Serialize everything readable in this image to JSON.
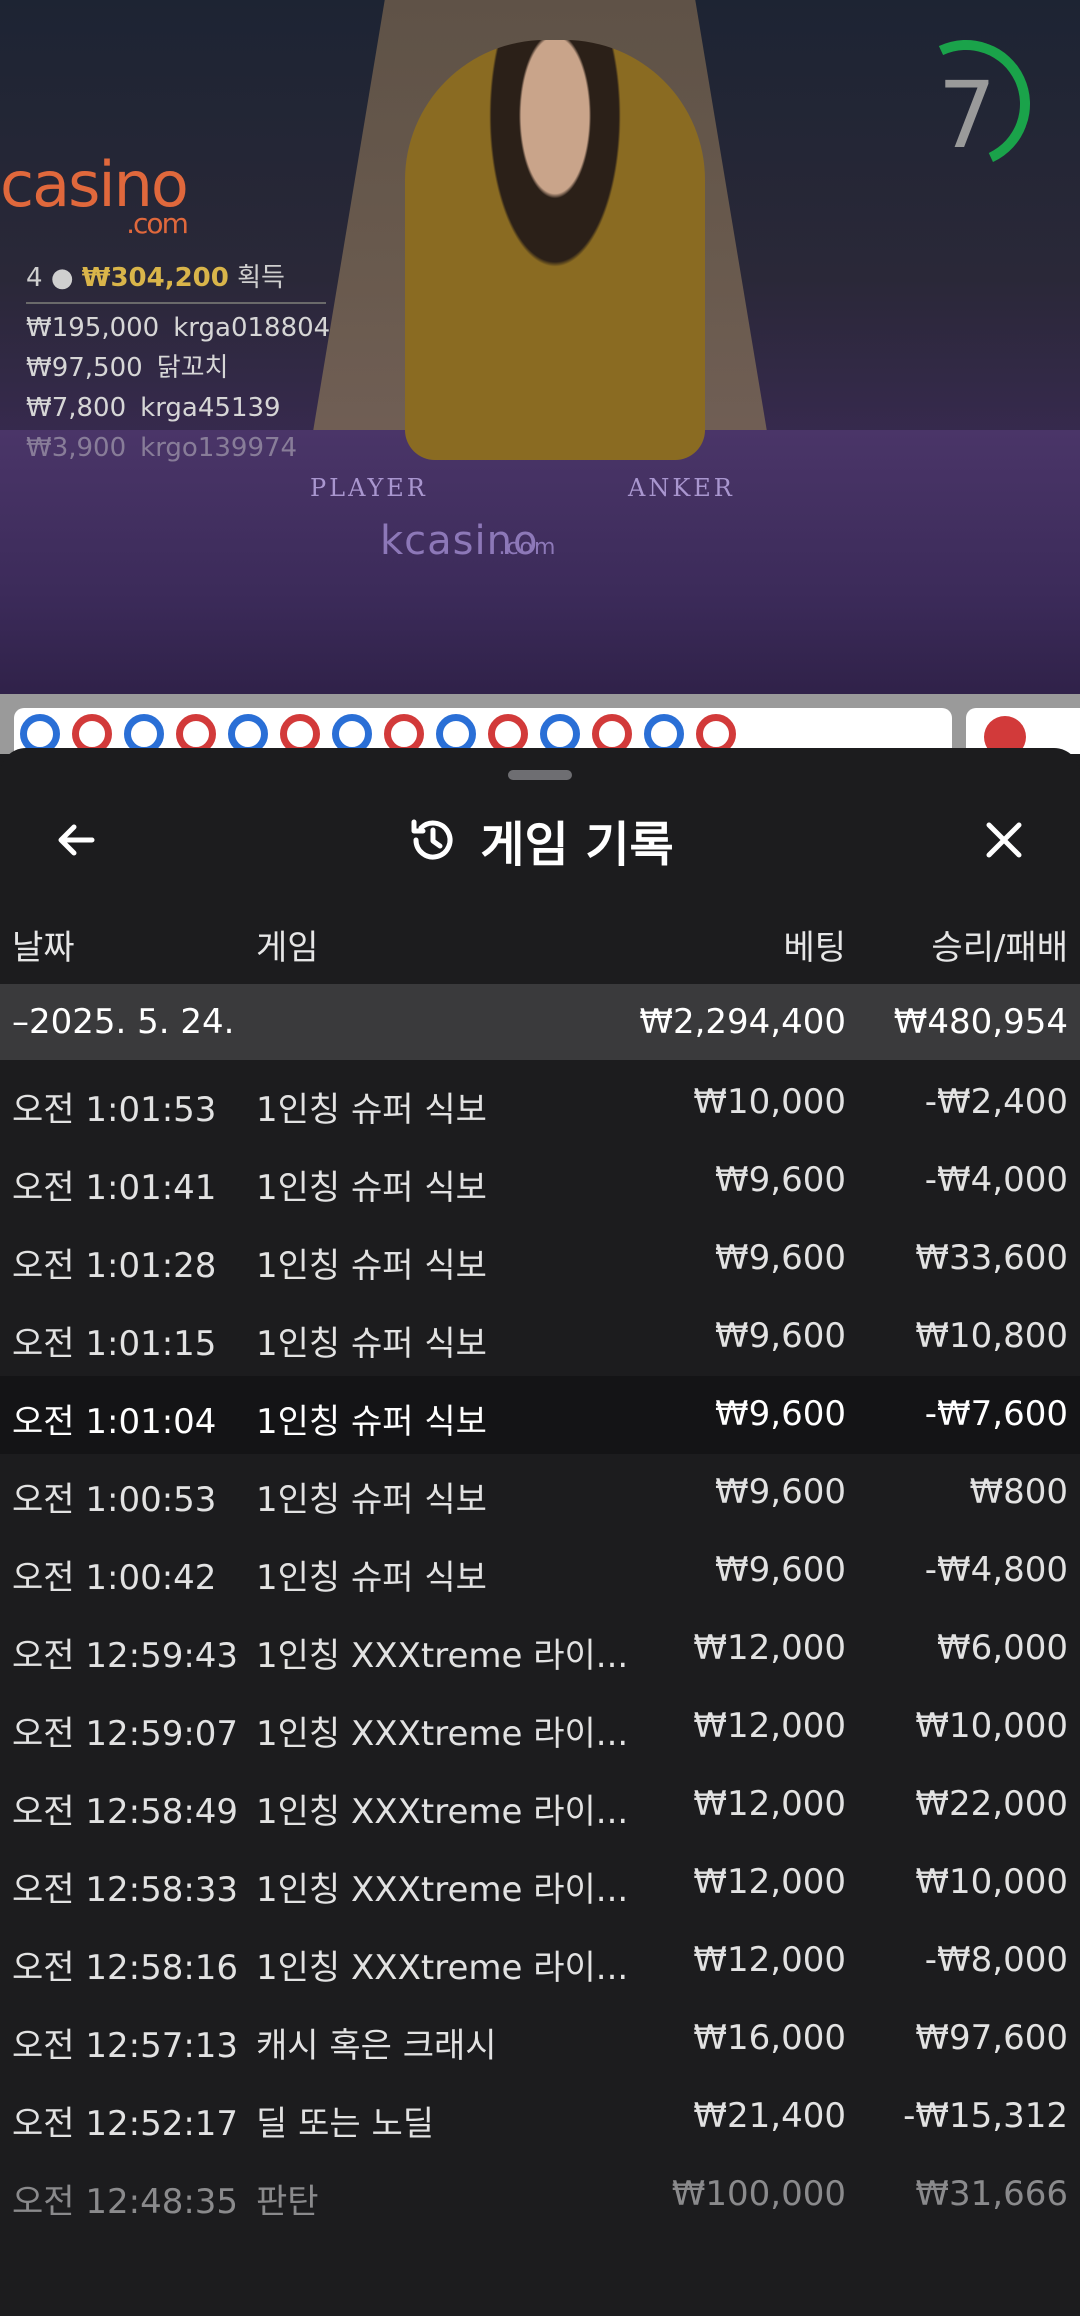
{
  "video": {
    "countdown": "7",
    "brand": "casino",
    "brand_sub": ".com",
    "felt_brand": "kcasino",
    "felt_brand_sub": ".com",
    "player_label": "PLAYER",
    "banker_label": "ANKER",
    "winners_header": {
      "count": "4",
      "total": "₩304,200",
      "suffix": "획득"
    },
    "winners": [
      {
        "amount": "₩195,000",
        "user": "krga018804"
      },
      {
        "amount": "₩97,500",
        "user": "닭꼬치"
      },
      {
        "amount": "₩7,800",
        "user": "krga45139"
      },
      {
        "amount": "₩3,900",
        "user": "krgo139974"
      }
    ]
  },
  "sheet": {
    "title": "게임 기록",
    "columns": {
      "date": "날짜",
      "game": "게임",
      "bet": "베팅",
      "result": "승리/패배"
    },
    "summary": {
      "date": "–2025. 5. 24.",
      "bet": "₩2,294,400",
      "result": "₩480,954"
    },
    "rows": [
      {
        "time": "오전 1:01:53",
        "game": "1인칭 슈퍼 식보",
        "bet": "₩10,000",
        "result": "-₩2,400"
      },
      {
        "time": "오전 1:01:41",
        "game": "1인칭 슈퍼 식보",
        "bet": "₩9,600",
        "result": "-₩4,000"
      },
      {
        "time": "오전 1:01:28",
        "game": "1인칭 슈퍼 식보",
        "bet": "₩9,600",
        "result": "₩33,600"
      },
      {
        "time": "오전 1:01:15",
        "game": "1인칭 슈퍼 식보",
        "bet": "₩9,600",
        "result": "₩10,800"
      },
      {
        "time": "오전 1:01:04",
        "game": "1인칭 슈퍼 식보",
        "bet": "₩9,600",
        "result": "-₩7,600"
      },
      {
        "time": "오전 1:00:53",
        "game": "1인칭 슈퍼 식보",
        "bet": "₩9,600",
        "result": "₩800"
      },
      {
        "time": "오전 1:00:42",
        "game": "1인칭 슈퍼 식보",
        "bet": "₩9,600",
        "result": "-₩4,800"
      },
      {
        "time": "오전 12:59:43",
        "game": "1인칭 XXXtreme 라이...",
        "bet": "₩12,000",
        "result": "₩6,000"
      },
      {
        "time": "오전 12:59:07",
        "game": "1인칭 XXXtreme 라이...",
        "bet": "₩12,000",
        "result": "₩10,000"
      },
      {
        "time": "오전 12:58:49",
        "game": "1인칭 XXXtreme 라이...",
        "bet": "₩12,000",
        "result": "₩22,000"
      },
      {
        "time": "오전 12:58:33",
        "game": "1인칭 XXXtreme 라이...",
        "bet": "₩12,000",
        "result": "₩10,000"
      },
      {
        "time": "오전 12:58:16",
        "game": "1인칭 XXXtreme 라이...",
        "bet": "₩12,000",
        "result": "-₩8,000"
      },
      {
        "time": "오전 12:57:13",
        "game": "캐시 혹은 크래시",
        "bet": "₩16,000",
        "result": "₩97,600"
      },
      {
        "time": "오전 12:52:17",
        "game": "딜 또는 노딜",
        "bet": "₩21,400",
        "result": "-₩15,312"
      },
      {
        "time": "오전 12:48:35",
        "game": "판탄",
        "bet": "₩100,000",
        "result": "₩31,666"
      }
    ]
  },
  "colors": {
    "sheet_bg": "#1c1c1e",
    "summary_bg": "#3a3a3c",
    "highlight_bg": "#141416",
    "countdown": "#1aa34a",
    "player_bead": "#2a6fd6",
    "banker_bead": "#d23a3a"
  },
  "icons": {
    "back": "arrow-left-icon",
    "history": "history-icon",
    "close": "close-icon"
  }
}
